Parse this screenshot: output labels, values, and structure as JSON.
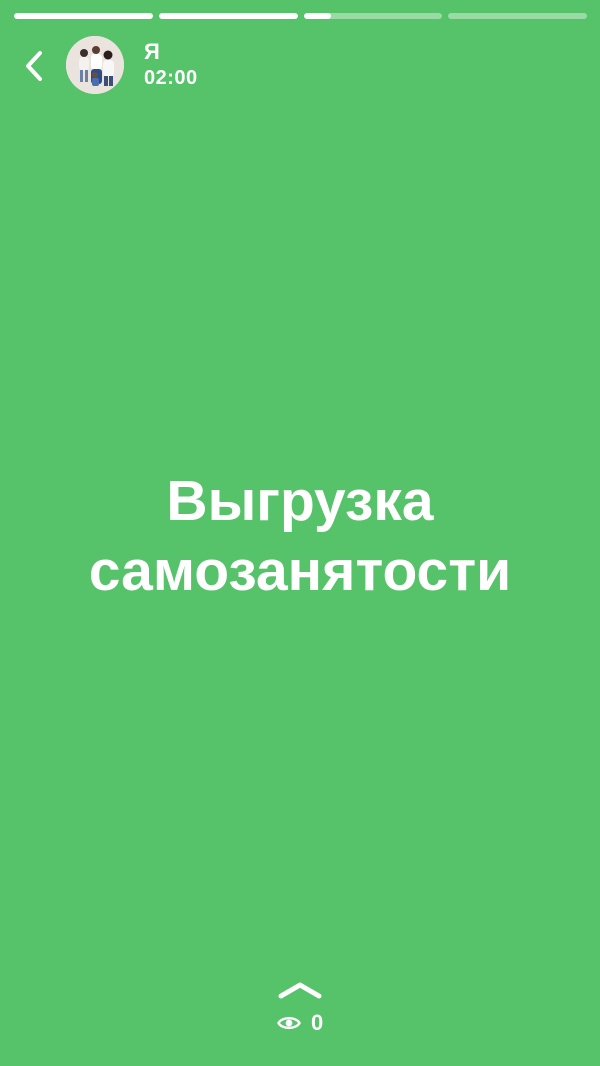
{
  "progress": [
    {
      "fill": 1.0
    },
    {
      "fill": 1.0
    },
    {
      "fill": 0.2
    },
    {
      "fill": 0.0
    }
  ],
  "header": {
    "user_name": "Я",
    "time": "02:00",
    "back_icon": "chevron-left-icon",
    "avatar": "user-avatar"
  },
  "story": {
    "title_line1": "Выгрузка",
    "title_line2": "самозанятости"
  },
  "footer": {
    "swipe_icon": "chevron-up-icon",
    "views_icon": "eye-icon",
    "views_count": "0"
  },
  "colors": {
    "background": "#56C26A",
    "foreground": "#FFFFFF"
  }
}
